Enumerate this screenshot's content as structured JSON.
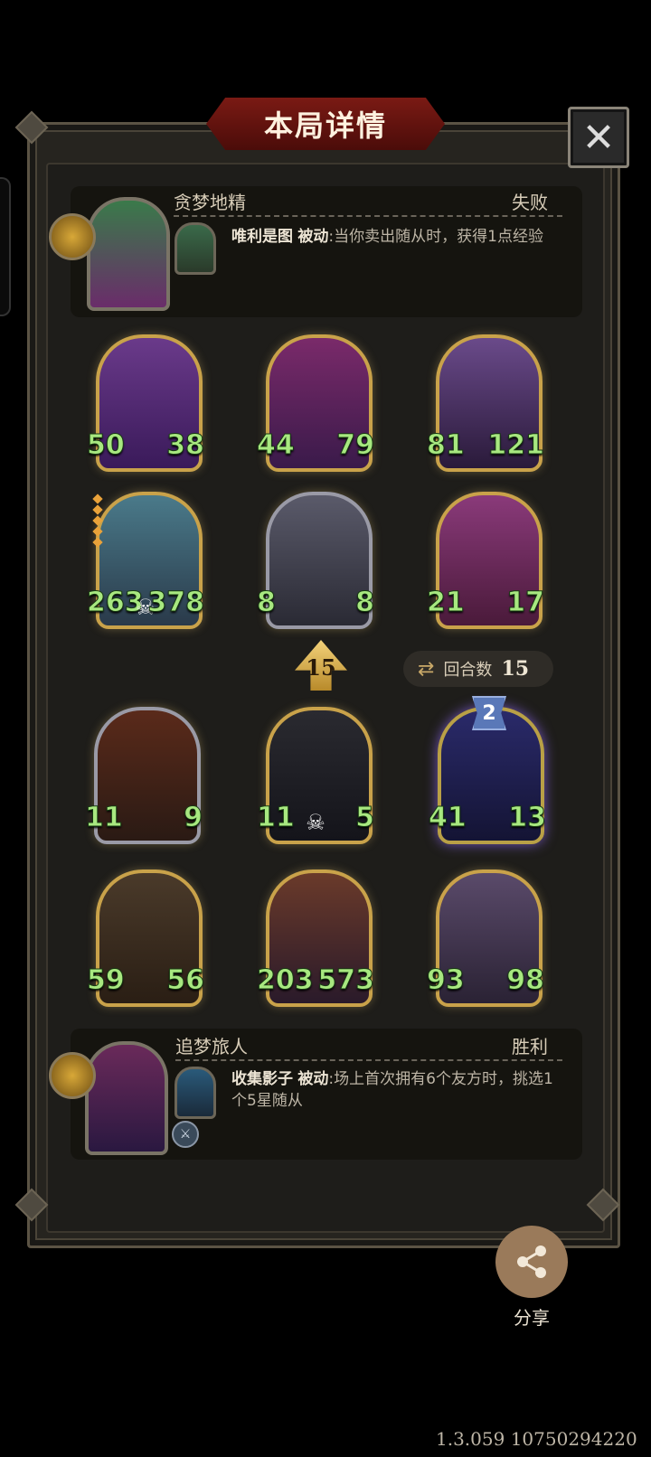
{
  "title": "本局详情",
  "close_icon": "✕",
  "top_player": {
    "name": "贪梦地精",
    "result": "失败",
    "skill_name": "唯利是图",
    "skill_tag": "被动",
    "skill_desc": ":当你卖出随从时，获得1点经验"
  },
  "bottom_player": {
    "name": "追梦旅人",
    "result": "胜利",
    "skill_name": "收集影子",
    "skill_tag": "被动",
    "skill_desc": ":场上首次拥有6个友方时，挑选1个5星随从"
  },
  "opponent_minions": [
    {
      "atk": "50",
      "hp": "38"
    },
    {
      "atk": "44",
      "hp": "79"
    },
    {
      "atk": "81",
      "hp": "121"
    },
    {
      "atk": "263",
      "hp": "378"
    },
    {
      "atk": "8",
      "hp": "8"
    },
    {
      "atk": "21",
      "hp": "17"
    }
  ],
  "player_minions": [
    {
      "atk": "11",
      "hp": "9"
    },
    {
      "atk": "11",
      "hp": "5"
    },
    {
      "atk": "41",
      "hp": "13"
    },
    {
      "atk": "59",
      "hp": "56"
    },
    {
      "atk": "203",
      "hp": "573"
    },
    {
      "atk": "93",
      "hp": "98"
    }
  ],
  "level_arrow": "15",
  "round": {
    "label": "回合数",
    "value": "15"
  },
  "level_badge": "2",
  "share_label": "分享",
  "version": "1.3.059 10750294220",
  "colors": {
    "stat_green": "#a8e880",
    "title_red": "#7a1a14",
    "gold": "#c9a24a"
  }
}
